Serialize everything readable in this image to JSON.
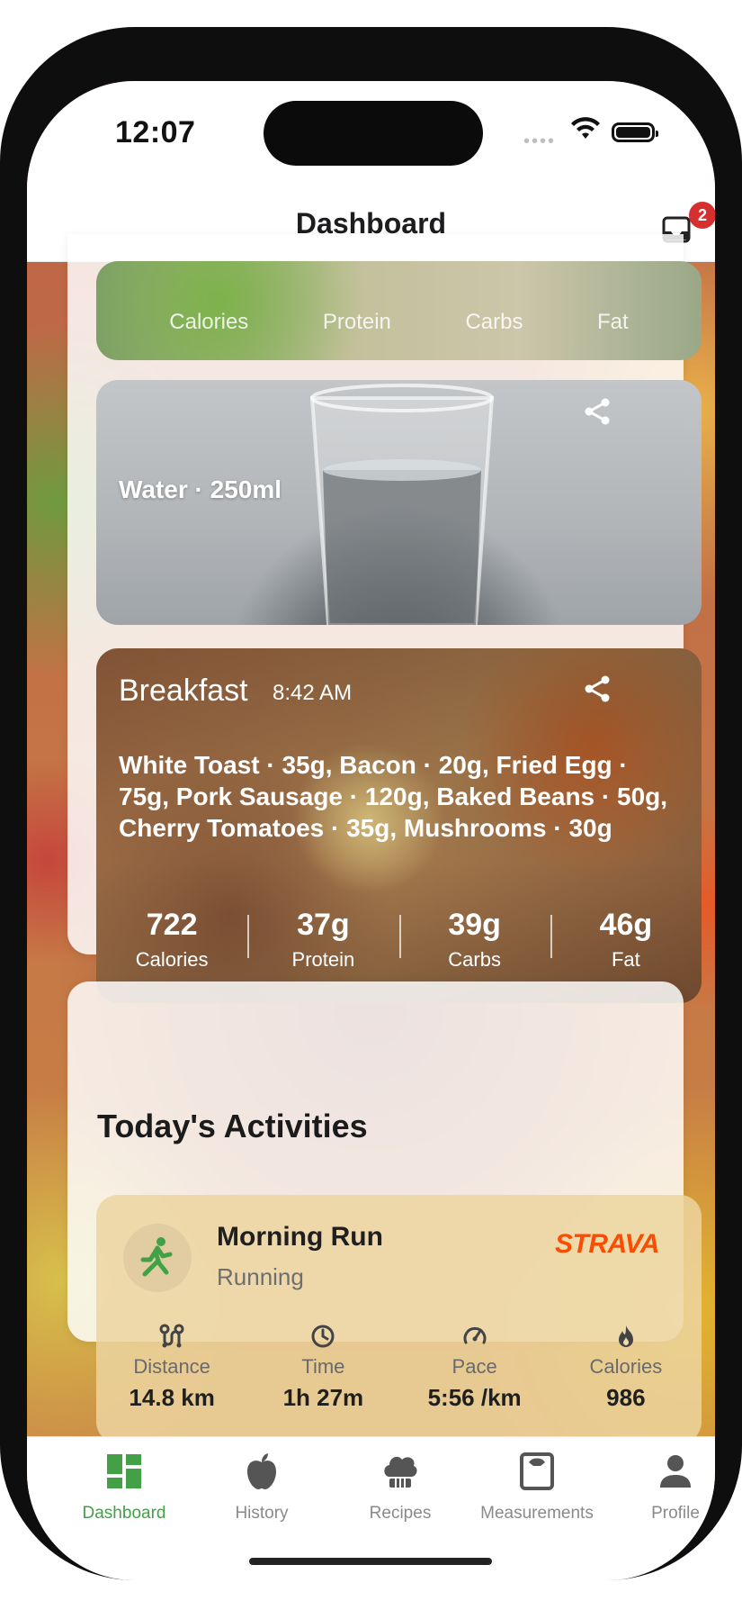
{
  "status_bar": {
    "time": "12:07"
  },
  "header": {
    "title": "Dashboard",
    "notification_count": "2"
  },
  "partial_card": {
    "labels": [
      "Calories",
      "Protein",
      "Carbs",
      "Fat"
    ]
  },
  "water_card": {
    "label": "Water · 250ml"
  },
  "breakfast_card": {
    "title": "Breakfast",
    "time": "8:42 AM",
    "items": "White Toast · 35g, Bacon · 20g, Fried Egg · 75g, Pork Sausage · 120g, Baked Beans · 50g, Cherry Tomatoes · 35g, Mushrooms · 30g",
    "stats": [
      {
        "value": "722",
        "label": "Calories"
      },
      {
        "value": "37g",
        "label": "Protein"
      },
      {
        "value": "39g",
        "label": "Carbs"
      },
      {
        "value": "46g",
        "label": "Fat"
      }
    ]
  },
  "activities": {
    "title": "Today's Activities",
    "items": [
      {
        "name": "Morning Run",
        "type": "Running",
        "provider": "STRAVA",
        "stats": [
          {
            "label": "Distance",
            "value": "14.8 km",
            "icon": "route-icon"
          },
          {
            "label": "Time",
            "value": "1h 27m",
            "icon": "clock-icon"
          },
          {
            "label": "Pace",
            "value": "5:56 /km",
            "icon": "speedometer-icon"
          },
          {
            "label": "Calories",
            "value": "986",
            "icon": "flame-icon"
          }
        ]
      }
    ]
  },
  "tabbar": {
    "items": [
      {
        "label": "Dashboard",
        "icon": "dashboard-icon",
        "active": true
      },
      {
        "label": "History",
        "icon": "apple-icon",
        "active": false
      },
      {
        "label": "Recipes",
        "icon": "chef-hat-icon",
        "active": false
      },
      {
        "label": "Measurements",
        "icon": "scale-icon",
        "active": false
      },
      {
        "label": "Profile",
        "icon": "person-icon",
        "active": false
      }
    ]
  },
  "colors": {
    "accent": "#43a047",
    "badge": "#d62f2f",
    "strava": "#fc4c02"
  }
}
